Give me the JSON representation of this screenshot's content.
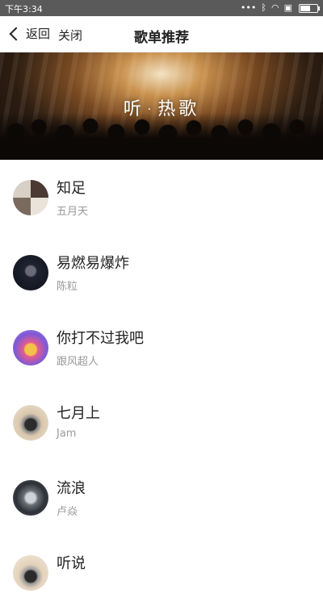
{
  "status_bar": {
    "time": "下午3:34",
    "icons": [
      "dots-icon",
      "bluetooth-icon",
      "wifi-icon",
      "sim-icon",
      "battery-icon"
    ],
    "battery_level": 0.6
  },
  "navbar": {
    "back_label": "返回",
    "close_label": "关闭",
    "title": "歌单推荐"
  },
  "banner": {
    "text_left": "听",
    "text_right": "热歌"
  },
  "songs": [
    {
      "title": "知足",
      "artist": "五月天"
    },
    {
      "title": "易燃易爆炸",
      "artist": "陈粒"
    },
    {
      "title": "你打不过我吧",
      "artist": "跟风超人"
    },
    {
      "title": "七月上",
      "artist": "Jam"
    },
    {
      "title": "流浪",
      "artist": "卢焱"
    },
    {
      "title": "听说",
      "artist": ""
    }
  ]
}
